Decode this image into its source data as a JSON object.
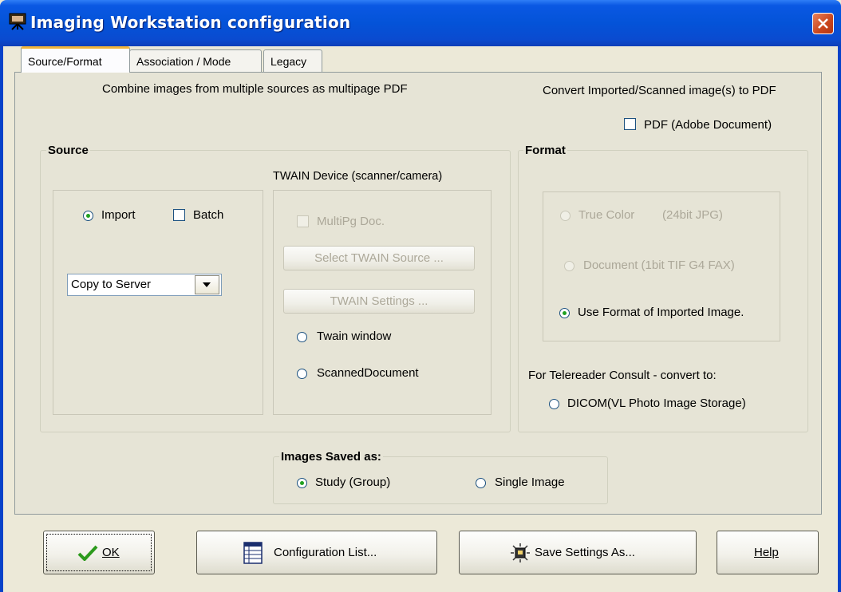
{
  "window": {
    "title": "Imaging Workstation configuration"
  },
  "tabs": [
    "Source/Format",
    "Association / Mode",
    "Legacy"
  ],
  "header": {
    "combine_text": "Combine images from multiple sources as multipage PDF",
    "convert_text": "Convert Imported/Scanned image(s) to PDF",
    "pdf_label": "PDF (Adobe Document)"
  },
  "source": {
    "title": "Source",
    "twain_caption": "TWAIN Device (scanner/camera)",
    "import_label": "Import",
    "batch_label": "Batch",
    "combo_value": "Copy to Server",
    "multipg_label": "MultiPg Doc.",
    "select_twain_btn": "Select TWAIN Source ...",
    "twain_settings_btn": "TWAIN Settings ...",
    "twain_window_label": "Twain window",
    "scanned_doc_label": "ScannedDocument"
  },
  "format": {
    "title": "Format",
    "true_color_label": "True Color",
    "true_color_detail": "(24bit JPG)",
    "document_label": "Document (1bit TIF G4 FAX)",
    "use_format_label": "Use Format of Imported Image.",
    "telereader_text": "For Telereader Consult - convert to:",
    "dicom_label": "DICOM(VL Photo Image Storage)"
  },
  "saved_as": {
    "title": "Images Saved as:",
    "study_label": "Study (Group)",
    "single_label": "Single Image"
  },
  "buttons": {
    "ok": "OK",
    "config_list": "Configuration List...",
    "save_settings": "Save Settings As...",
    "help": "Help"
  },
  "colors": {
    "titlebar": "#0453d8",
    "panel": "#e6e4d6",
    "dialog": "#ece9d8",
    "radio_on": "#21a121"
  }
}
